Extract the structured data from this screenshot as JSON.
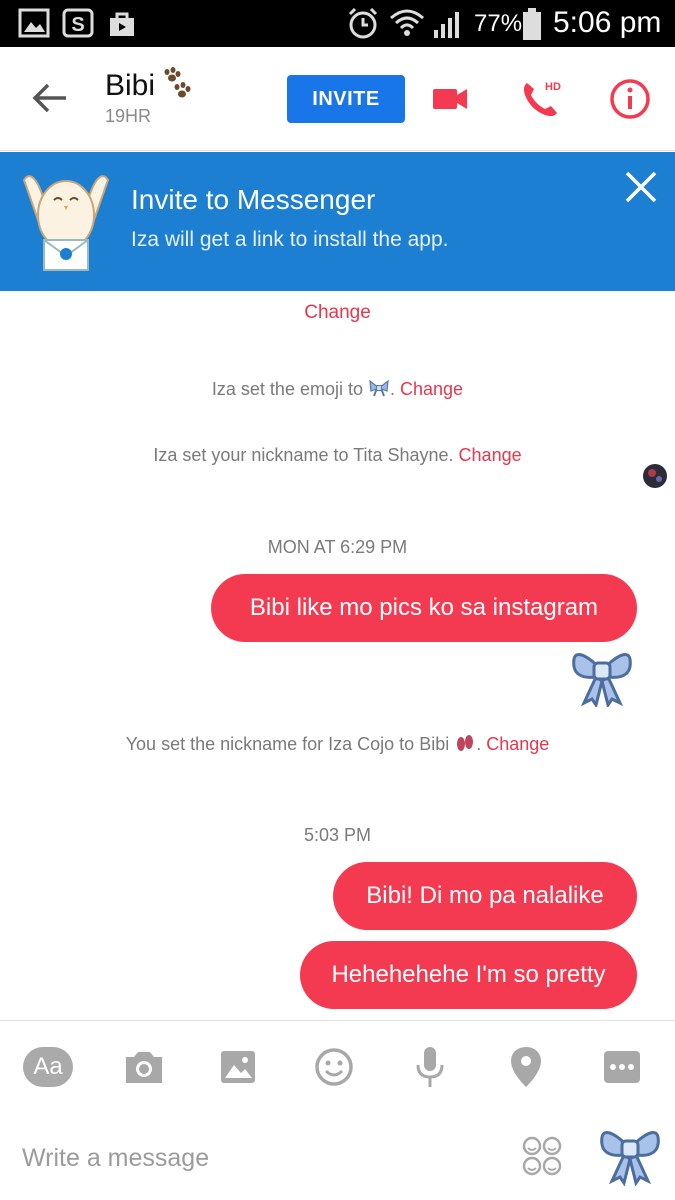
{
  "status_bar": {
    "battery_percent": "77%",
    "time": "5:06 pm"
  },
  "header": {
    "title": "Bibi",
    "subtitle": "19HR",
    "invite_label": "INVITE"
  },
  "banner": {
    "title": "Invite to Messenger",
    "subtitle": "Iza will get a link to install the app."
  },
  "conversation": {
    "top_change": "Change",
    "event_emoji_text": "Iza set the emoji to",
    "event_emoji_change": "Change",
    "event_nickname_text": "Iza set your nickname to Tita Shayne.",
    "event_nickname_change": "Change",
    "timestamp_1": "MON AT 6:29 PM",
    "message_1": "Bibi like mo pics ko sa instagram",
    "event_nickname2_text": "You set the nickname for Iza Cojo to Bibi",
    "event_nickname2_change": "Change",
    "timestamp_2": "5:03 PM",
    "message_2": "Bibi! Di mo pa nalalike",
    "message_3": "Hehehehehe I'm so pretty"
  },
  "composer": {
    "aa_label": "Aa",
    "placeholder": "Write a message"
  },
  "colors": {
    "accent": "#f43a50",
    "messenger_blue": "#1976e8",
    "banner_blue": "#1d7fd2"
  }
}
